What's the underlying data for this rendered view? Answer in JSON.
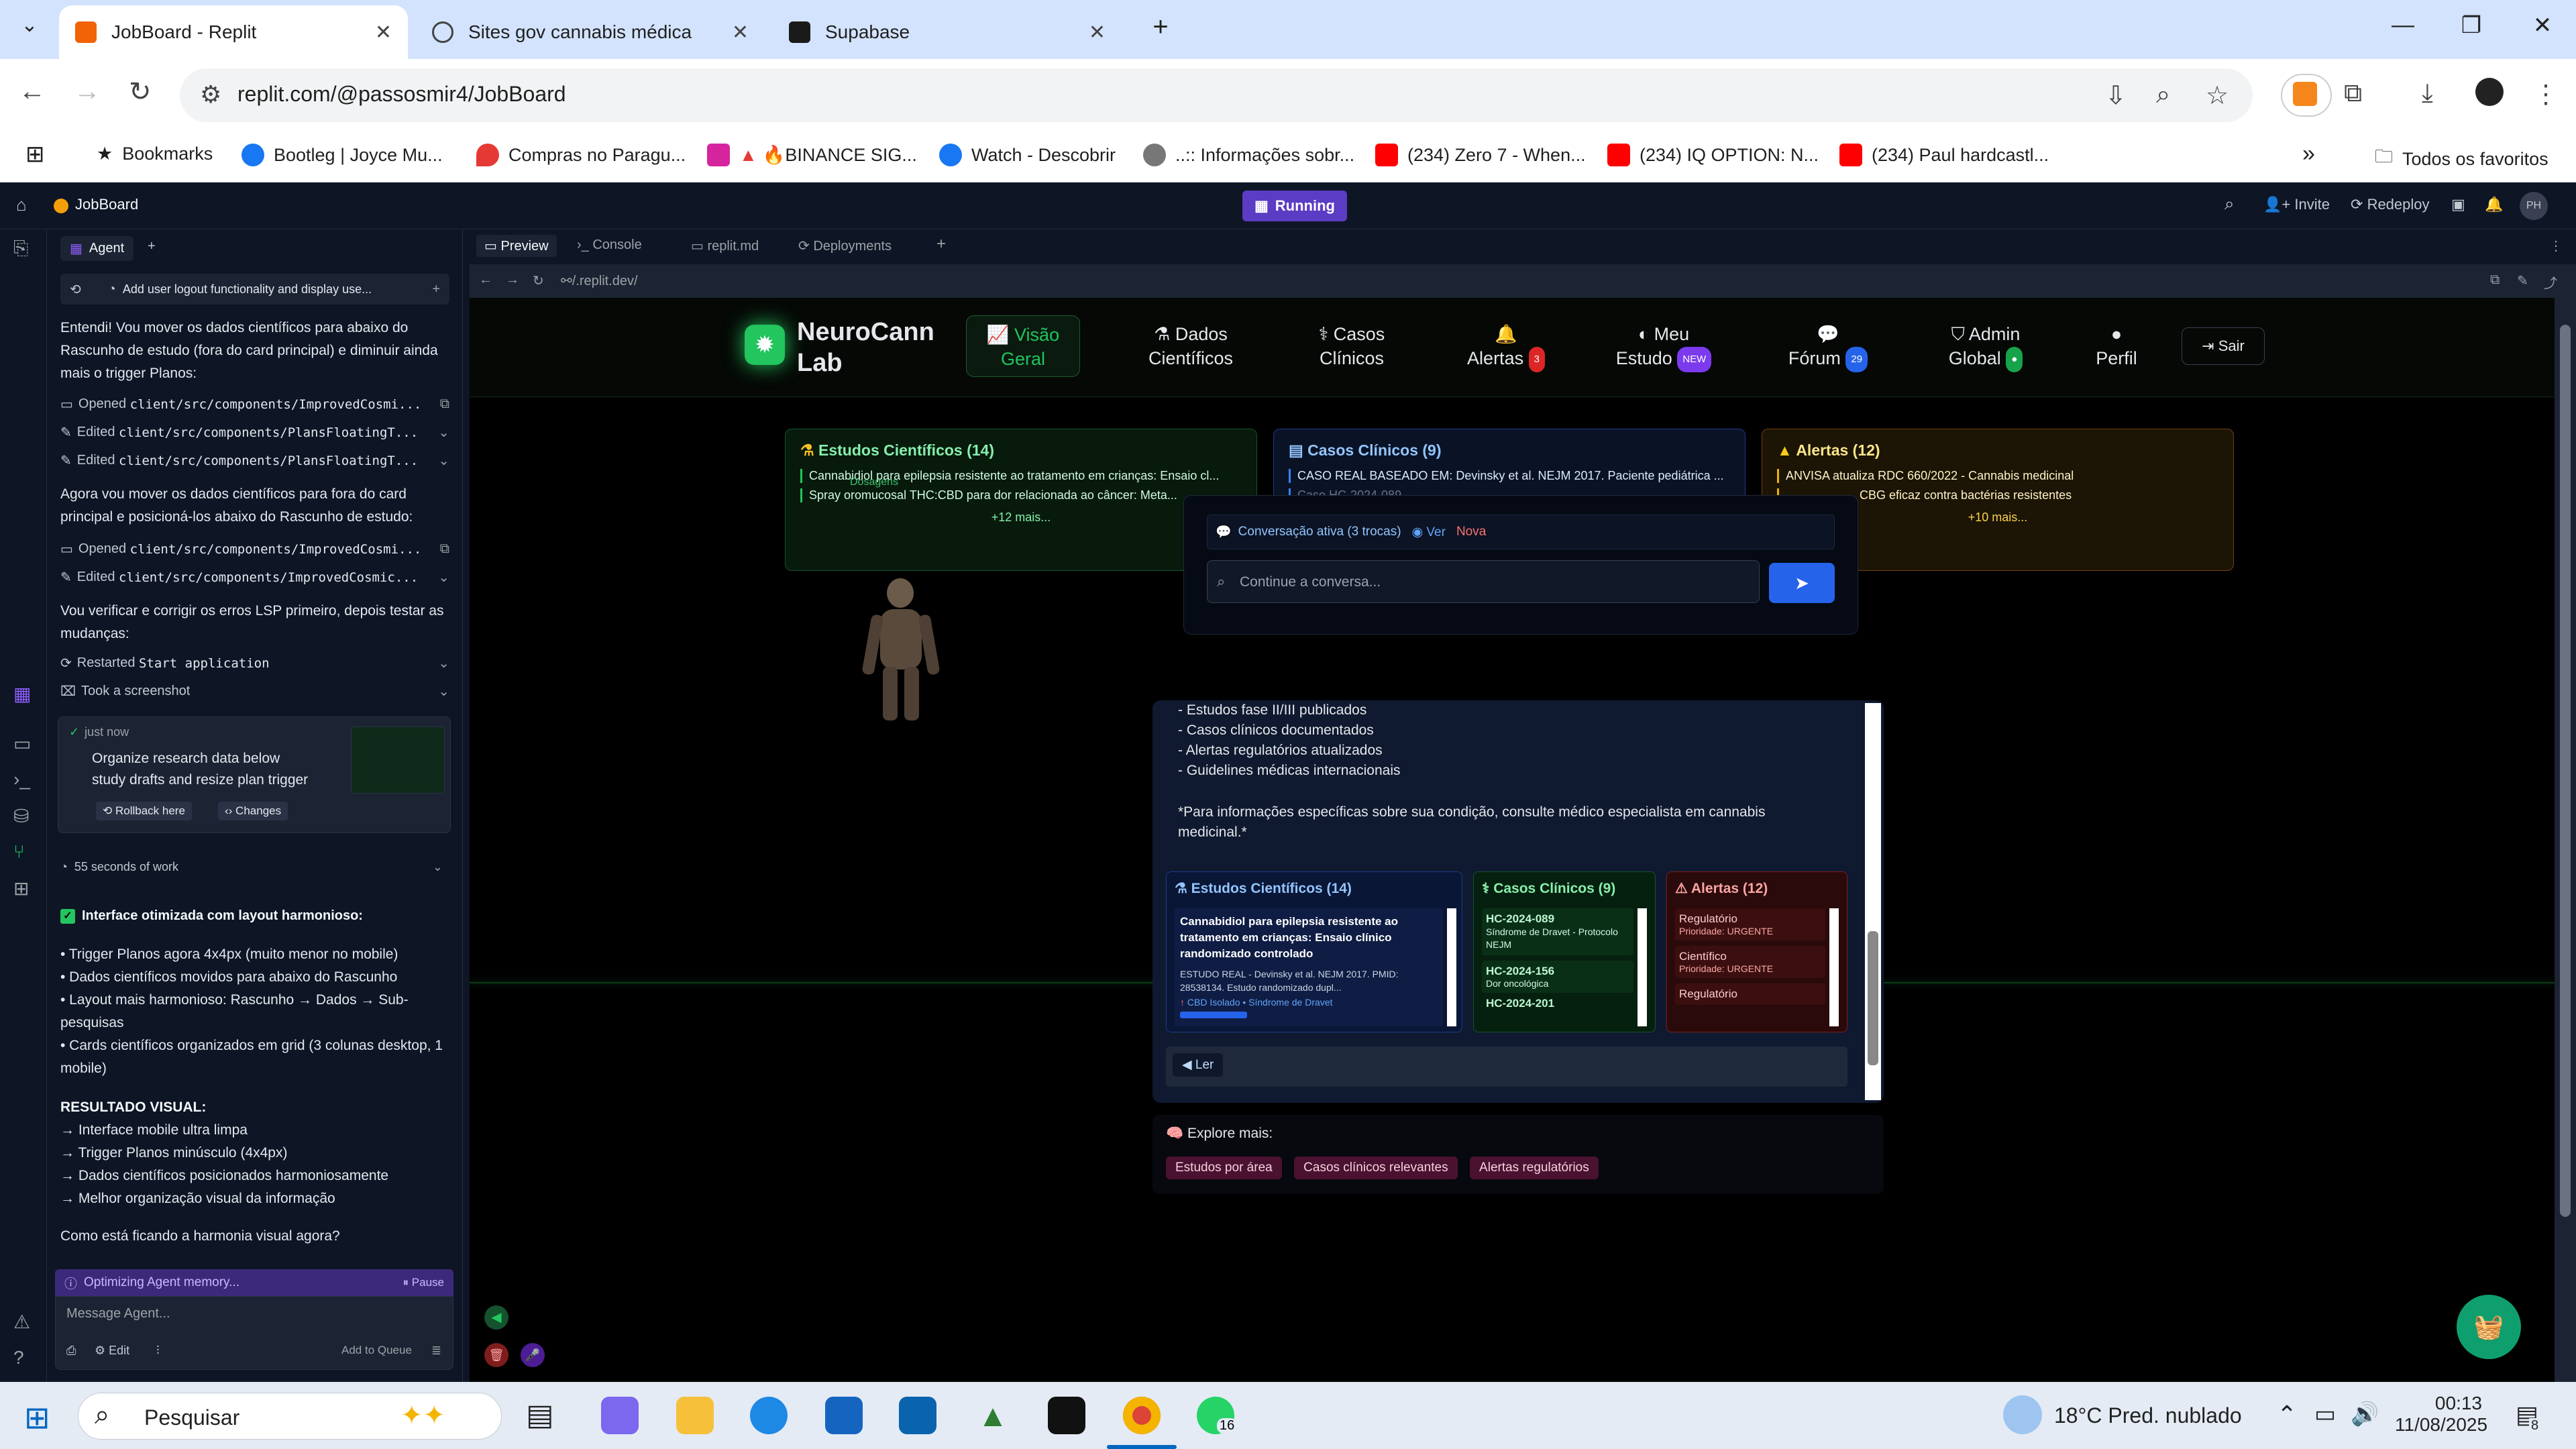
{
  "browser": {
    "tabs": [
      {
        "title": "JobBoard - Replit",
        "active": true
      },
      {
        "title": "Sites gov cannabis médica",
        "active": false
      },
      {
        "title": "Supabase",
        "active": false
      }
    ],
    "new_tab": "+",
    "url": "replit.com/@passosmir4/JobBoard",
    "bookmarks": [
      "Bookmarks",
      "Bootleg | Joyce Mu...",
      "Compras no Paragu...",
      "🔥BINANCE SIG...",
      "Watch - Descobrir",
      "..:: Informações sobr...",
      "(234) Zero 7 - When...",
      "(234) IQ OPTION: N...",
      "(234) Paul hardcastl..."
    ],
    "bookmarks_overflow": "»",
    "all_favorites": "Todos os favoritos"
  },
  "replit": {
    "project": "JobBoard",
    "status": "Running",
    "invite": "Invite",
    "redeploy": "Redeploy",
    "avatar": "PH",
    "workspace_tabs": [
      "Preview",
      "Console",
      "replit.md",
      "Deployments"
    ],
    "preview_url": "/.replit.dev/"
  },
  "agent": {
    "tab": "Agent",
    "history_title": "Add user logout functionality and display use...",
    "msg1": "Entendi! Vou mover os dados científicos para abaixo do Rascunho de estudo (fora do card principal) e diminuir ainda mais o trigger Planos:",
    "act1": {
      "verb": "Opened",
      "file": "client/src/components/ImprovedCosmi..."
    },
    "act2": {
      "verb": "Edited",
      "file": "client/src/components/PlansFloatingT..."
    },
    "act3": {
      "verb": "Edited",
      "file": "client/src/components/PlansFloatingT..."
    },
    "msg2": "Agora vou mover os dados científicos para fora do card principal e posicioná-los abaixo do Rascunho de estudo:",
    "act4": {
      "verb": "Opened",
      "file": "client/src/components/ImprovedCosmi..."
    },
    "act5": {
      "verb": "Edited",
      "file": "client/src/components/ImprovedCosmic..."
    },
    "msg3": "Vou verificar e corrigir os erros LSP primeiro, depois testar as mudanças:",
    "act6": {
      "verb": "Restarted",
      "file": "Start application"
    },
    "act7": {
      "verb": "Took a screenshot",
      "file": ""
    },
    "checkpoint": {
      "time": "just now",
      "text": "Organize research data below study drafts and resize plan trigger",
      "rollback": "Rollback here",
      "changes": "Changes"
    },
    "work_time": "55 seconds of work",
    "summary_title": "Interface otimizada com layout harmonioso:",
    "bullets": [
      "• Trigger Planos agora 4x4px (muito menor no mobile)",
      "• Dados científicos movidos para abaixo do Rascunho",
      "• Layout mais harmonioso: Rascunho → Dados → Sub-pesquisas",
      "• Cards científicos organizados em grid (3 colunas desktop, 1 mobile)"
    ],
    "result_title": "RESULTADO VISUAL:",
    "results": [
      "→ Interface mobile ultra limpa",
      "→ Trigger Planos minúsculo (4x4px)",
      "→ Dados científicos posicionados harmoniosamente",
      "→ Melhor organização visual da informação"
    ],
    "question": "Como está ficando a harmonia visual agora?",
    "status": "Optimizing Agent memory...",
    "pause": "Pause",
    "placeholder": "Message Agent...",
    "edit": "Edit",
    "queue": "Add to Queue"
  },
  "app": {
    "brand_line1": "NeuroCann",
    "brand_line2": "Lab",
    "nav": [
      {
        "l1": "Visão",
        "l2": "Geral",
        "badge": ""
      },
      {
        "l1": "Dados",
        "l2": "Científicos",
        "badge": ""
      },
      {
        "l1": "Casos",
        "l2": "Clínicos",
        "badge": ""
      },
      {
        "l1": "",
        "l2": "Alertas",
        "badge": "3"
      },
      {
        "l1": "Meu",
        "l2": "Estudo",
        "badge": "NEW"
      },
      {
        "l1": "",
        "l2": "Fórum",
        "badge": "29"
      },
      {
        "l1": "Admin",
        "l2": "Global",
        "badge": ""
      },
      {
        "l1": "",
        "l2": "Perfil",
        "badge": ""
      }
    ],
    "logout": "Sair",
    "cards": {
      "studies": {
        "title": "Estudos Científicos (14)",
        "line1": "Cannabidiol para epilepsia resistente ao tratamento em crianças: Ensaio cl...",
        "line2": "Spray oromucosal THC:CBD para dor relacionada ao câncer: Meta...",
        "more": "+12 mais...",
        "overlay": "Dosagens"
      },
      "cases": {
        "title": "Casos Clínicos (9)",
        "line1": "CASO REAL BASEADO EM: Devinsky et al. NEJM 2017. Paciente pediátrica ...",
        "line2": "Caso HC-2024-089"
      },
      "alerts": {
        "title": "Alertas (12)",
        "line1": "ANVISA atualiza RDC 660/2022 - Cannabis medicinal",
        "line2": "CBG eficaz contra bactérias resistentes",
        "more": "+10 mais..."
      }
    },
    "conversation": {
      "active": "Conversação ativa (3 trocas)",
      "view": "Ver",
      "new": "Nova",
      "placeholder": "Continue a conversa..."
    },
    "chat": {
      "list": [
        "- Estudos fase II/III publicados",
        "- Casos clínicos documentados",
        "- Alertas regulatórios atualizados",
        "- Guidelines médicas internacionais"
      ],
      "note": "*Para informações específicas sobre sua condição, consulte médico especialista em cannabis medicinal.*",
      "mini_studies": {
        "title": "Estudos Científicos (14)",
        "item_title": "Cannabidiol para epilepsia resistente ao tratamento em crianças: Ensaio clínico randomizado controlado",
        "item_body": "ESTUDO REAL - Devinsky et al. NEJM 2017. PMID: 28538134. Estudo randomizado dupl...",
        "item_tags": "CBD Isolado • Síndrome de Dravet"
      },
      "mini_cases": {
        "title": "Casos Clínicos (9)",
        "c1": "HC-2024-089",
        "c1_desc": "Síndrome de Dravet - Protocolo NEJM",
        "c2": "HC-2024-156",
        "c2_desc": "Dor oncológica",
        "c3": "HC-2024-201"
      },
      "mini_alerts": {
        "title": "Alertas (12)",
        "a1": "Regulatório",
        "a1_p": "Prioridade: URGENTE",
        "a2": "Científico",
        "a2_p": "Prioridade: URGENTE",
        "a3": "Regulatório"
      },
      "read": "Ler"
    },
    "explore": {
      "title": "Explore mais:",
      "chips": [
        "Estudos por área",
        "Casos clínicos relevantes",
        "Alertas regulatórios"
      ]
    }
  },
  "taskbar": {
    "search": "Pesquisar",
    "weather": "18°C  Pred. nublado",
    "time": "00:13",
    "date": "11/08/2025",
    "whatsapp_badge": "16",
    "notif_badge": "8"
  },
  "colors": {
    "replit_bg": "#0e1525",
    "accent_purple": "#5b3cc4",
    "app_green": "#22c55e",
    "alert_yellow": "#facc15",
    "case_blue": "#60a5fa",
    "send_blue": "#2563eb"
  }
}
